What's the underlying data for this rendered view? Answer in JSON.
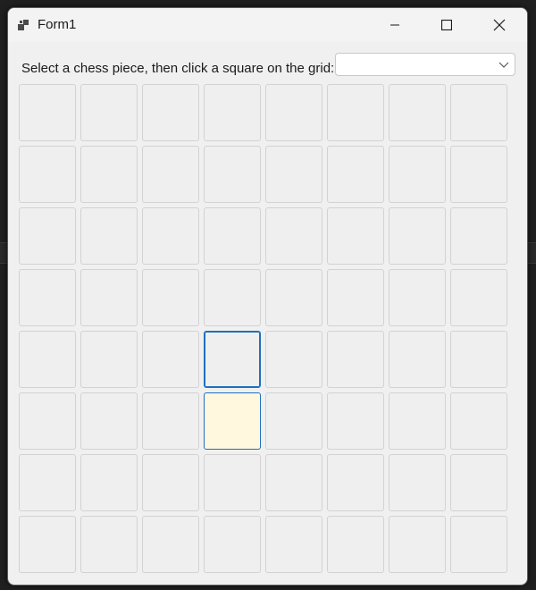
{
  "window": {
    "title": "Form1"
  },
  "prompt_label": "Select a chess piece, then click a square on the grid:",
  "piece_selector": {
    "selected_value": "",
    "options_visible": []
  },
  "board": {
    "rows": 8,
    "cols": 8,
    "focused_cell": {
      "row": 4,
      "col": 3
    },
    "highlighted_cells": [
      {
        "row": 5,
        "col": 3
      }
    ],
    "highlight_color": "#fff8df",
    "focus_color": "#1e6fbf",
    "cell_color": "#efefef"
  },
  "icons": {
    "app": "app-icon",
    "minimize": "minimize-icon",
    "maximize": "maximize-icon",
    "close": "close-icon",
    "dropdown": "chevron-down-icon"
  }
}
